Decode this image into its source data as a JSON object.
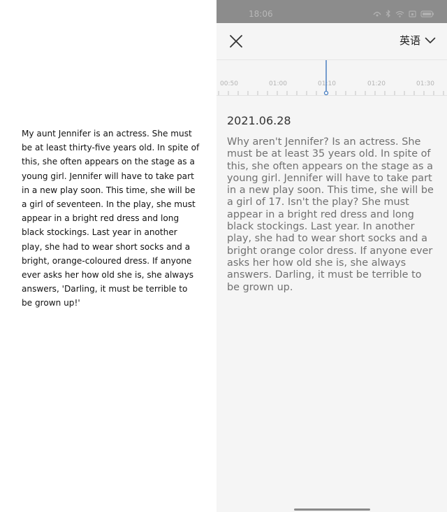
{
  "left_panel": {
    "original_text": "My aunt Jennifer is an actress. She must be at least thirty-five years old. In spite of this, she often appears on the stage as a young girl. Jennifer will have to take part in a new play soon. This time, she will be a girl of seventeen. In the play, she must appear in a bright red dress and long black stockings. Last year in another play, she had to wear short socks and a bright, orange-coloured dress. If anyone ever asks her how old she is, she always answers, 'Darling, it must be terrible to be grown up!'"
  },
  "status_bar": {
    "time": "18:06",
    "icons": [
      "alarm-icon",
      "bluetooth-icon",
      "wifi-icon",
      "screen-icon",
      "battery-icon"
    ],
    "color": "#8c8c8c"
  },
  "header": {
    "close_icon": "close-icon",
    "language_label": "英语",
    "chevron_icon": "chevron-down-icon"
  },
  "timeline": {
    "labels": [
      "00:50",
      "01:00",
      "01:10",
      "01:20",
      "01:30"
    ],
    "playhead_color": "#4a7fc1"
  },
  "transcript": {
    "date": "2021.06.28",
    "text": " Why aren't Jennifer? Is an actress. She must be at least 35 years old. In spite of this, she often appears on the stage as a young girl. Jennifer will have to take part in a new play soon. This time, she will be a girl of 17. Isn't the play? She must appear in a bright red dress and long black stockings. Last year. In another play, she had to wear short socks and a bright orange color dress. If anyone ever asks her how old she is, she always answers. Darling, it must be terrible to be grown up."
  }
}
